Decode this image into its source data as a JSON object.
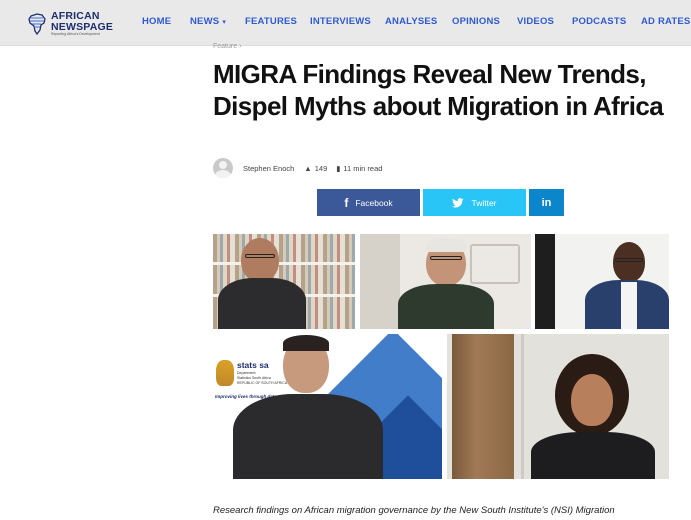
{
  "header": {
    "logo": {
      "line1": "AFRICAN",
      "line2": "NEWSPAGE",
      "tagline": "Reporting Africa's Development"
    },
    "nav": [
      {
        "label": "HOME"
      },
      {
        "label": "NEWS",
        "has_dropdown": true
      },
      {
        "label": "FEATURES"
      },
      {
        "label": "INTERVIEWS"
      },
      {
        "label": "ANALYSES"
      },
      {
        "label": "OPINIONS"
      },
      {
        "label": "VIDEOS"
      },
      {
        "label": "PODCASTS"
      },
      {
        "label": "AD RATES"
      }
    ],
    "colors": {
      "nav_text": "#2f5bd0",
      "bar_bg": "#e9e9ea"
    }
  },
  "article": {
    "breadcrumb": "Feature",
    "title": "MIGRA Findings Reveal New Trends, Dispel Myths about Migration in Africa",
    "author": "Stephen Enoch",
    "views": "149",
    "read_time": "11 min read",
    "share": {
      "facebook": "Facebook",
      "twitter": "Twitter",
      "linkedin": "in",
      "colors": {
        "facebook": "#3b5998",
        "twitter": "#29c5f6",
        "linkedin": "#0b86ca"
      }
    },
    "image": {
      "slide_logo": "stats sa",
      "slide_sub1": "Department:",
      "slide_sub2": "Statistics South Africa",
      "slide_sub3": "REPUBLIC OF SOUTH AFRICA",
      "slide_tagline": "Improving lives through data ecosy"
    },
    "lead": "Research findings on African migration governance by the New South Institute's (NSI) Migration"
  }
}
